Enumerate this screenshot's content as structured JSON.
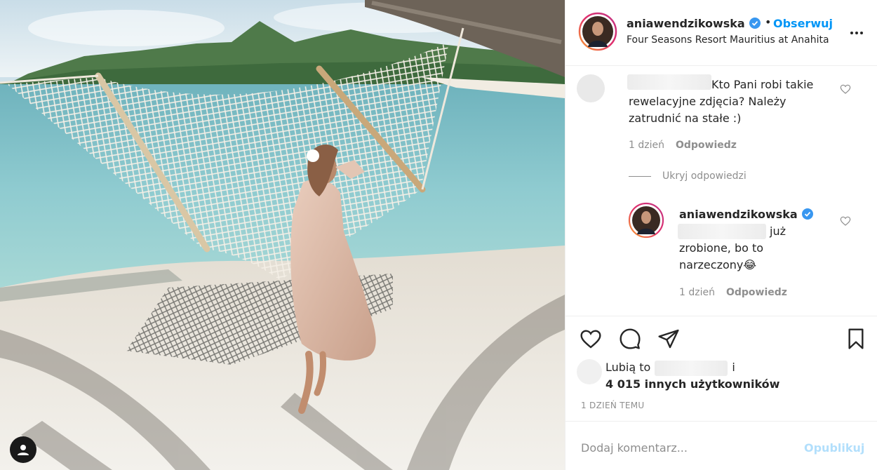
{
  "post": {
    "image_alt": "Woman in a satin robe sitting on a rope hammock on a tropical beach",
    "colors": {
      "sky": "#dbe9f0",
      "sea": "#7fc0c8",
      "sand": "#efece6",
      "mountain": "#4f7a4a"
    }
  },
  "header": {
    "username": "aniawendzikowska",
    "separator": "•",
    "follow_label": "Obserwuj",
    "location": "Four Seasons Resort Mauritius at Anahita",
    "more_icon": "more-horizontal-icon"
  },
  "comments": [
    {
      "text": "Kto Pani robi takie rewelacyjne zdjęcia? Należy zatrudnić na stałe :)",
      "time": "1 dzień",
      "reply_label": "Odpowiedz"
    }
  ],
  "replies_toggle": "Ukryj odpowiedzi",
  "reply": {
    "username": "aniawendzikowska",
    "text": "już zrobione, bo to narzeczony😂",
    "time": "1 dzień",
    "reply_label": "Odpowiedz"
  },
  "actions": {
    "likes_prefix": "Lubią to",
    "likes_and": "i",
    "likes_others": "4 015 innych użytkowników",
    "timestamp": "1 DZIEŃ TEMU"
  },
  "add_comment": {
    "placeholder": "Dodaj komentarz...",
    "publish_label": "Opublikuj"
  },
  "theme": {
    "accent": "#0095f6",
    "muted": "#8e8e8e",
    "text": "#262626",
    "publish_disabled": "#b2dffc"
  }
}
